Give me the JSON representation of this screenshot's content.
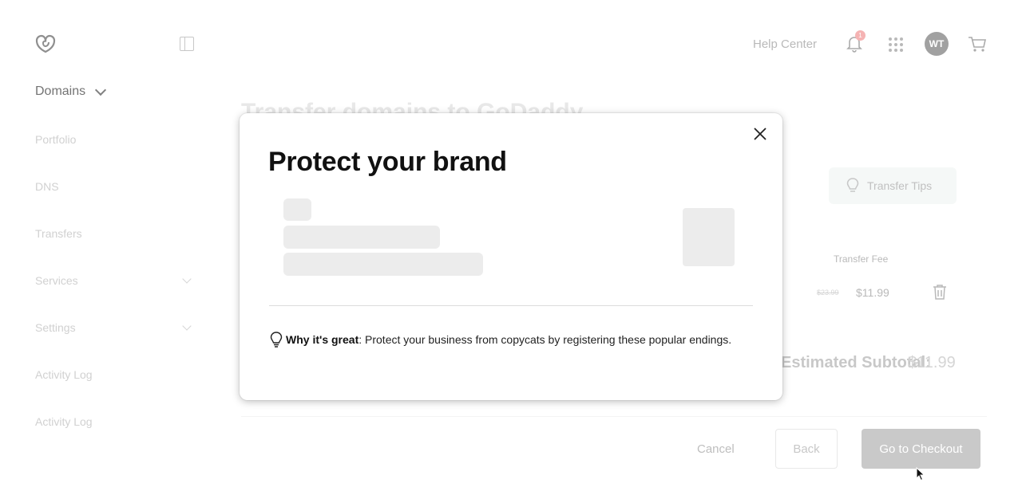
{
  "header": {
    "help_center": "Help Center",
    "notification_count": "1",
    "avatar_initials": "WT"
  },
  "sidebar": {
    "section": "Domains",
    "items": [
      {
        "label": "Portfolio"
      },
      {
        "label": "DNS"
      },
      {
        "label": "Transfers"
      },
      {
        "label": "Services"
      },
      {
        "label": "Settings"
      },
      {
        "label": "Activity Log"
      },
      {
        "label": "Activity Log"
      }
    ]
  },
  "main": {
    "title": "Transfer domains to GoDaddy",
    "transfer_tips": "Transfer Tips",
    "transfer_fee_header": "Transfer Fee",
    "old_price": "$23.99",
    "new_price": "$11.99",
    "subtotal_label": "Estimated Subtotal:",
    "subtotal_value": "$11.99",
    "cancel": "Cancel",
    "back": "Back",
    "checkout": "Go to Checkout"
  },
  "modal": {
    "title": "Protect your brand",
    "why_label": "Why it's great",
    "why_text": ": Protect your business from copycats by registering these popular endings."
  },
  "colors": {
    "checkout_bg": "#bdbdbd",
    "badge_bg": "#f3a3a3",
    "tips_bg": "#f3f7f6"
  }
}
